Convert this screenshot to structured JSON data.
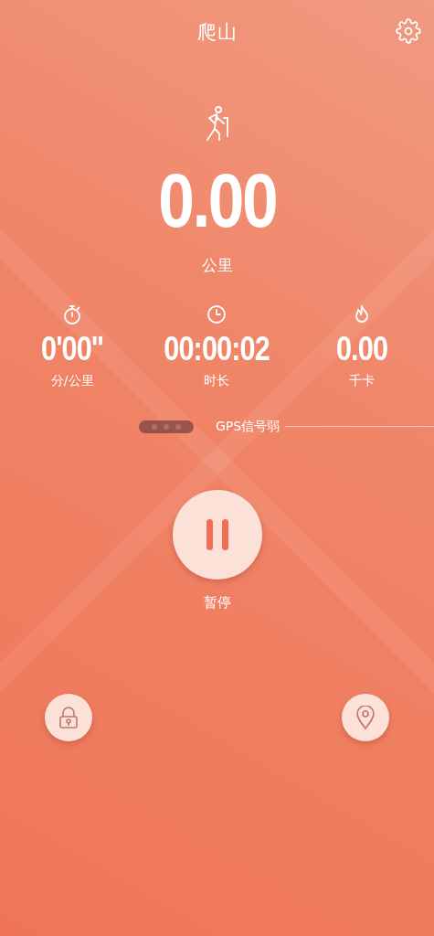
{
  "header": {
    "title": "爬山"
  },
  "distance": {
    "value": "0.00",
    "unit": "公里"
  },
  "stats": [
    {
      "kind": "pace",
      "value": "0'00''",
      "label": "分/公里"
    },
    {
      "kind": "duration",
      "value": "00:00:02",
      "label": "时长"
    },
    {
      "kind": "calories",
      "value": "0.00",
      "label": "千卡"
    }
  ],
  "gps": {
    "status": "GPS信号弱"
  },
  "pause_button": {
    "label": "暂停"
  }
}
